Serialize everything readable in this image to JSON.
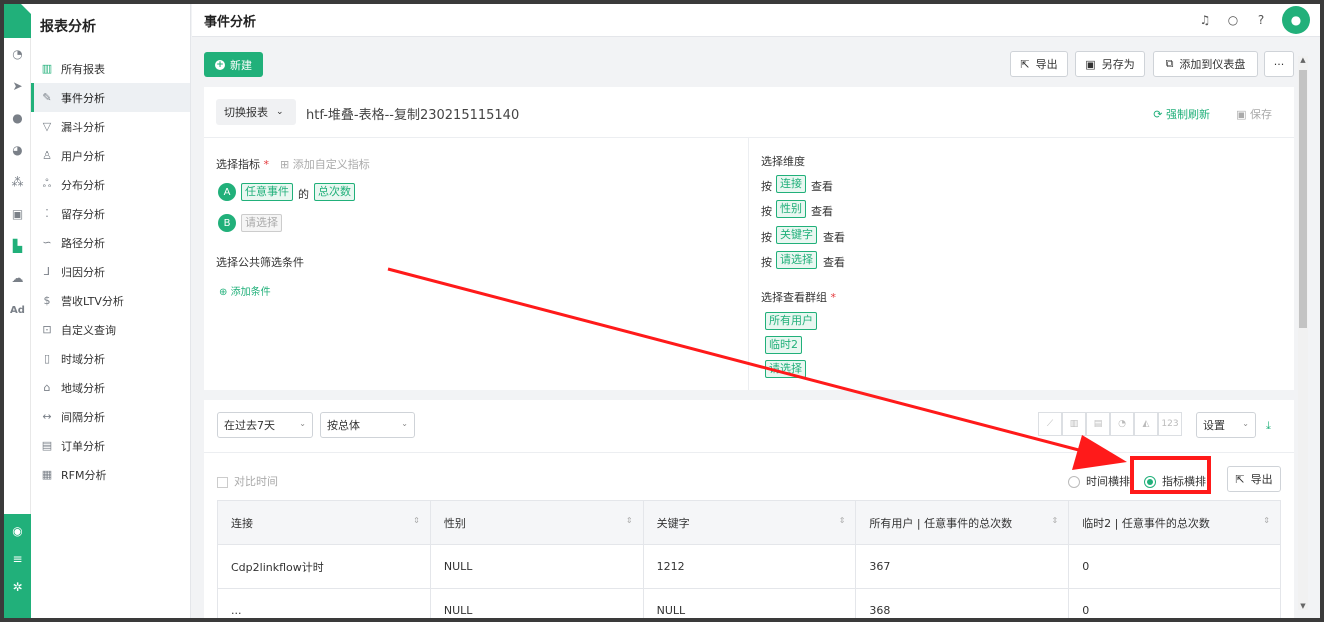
{
  "sidebar": {
    "title": "报表分析",
    "items": [
      {
        "label": "所有报表",
        "icon": "bar-chart-icon"
      },
      {
        "label": "事件分析",
        "icon": "edit-icon"
      },
      {
        "label": "漏斗分析",
        "icon": "funnel-icon"
      },
      {
        "label": "用户分析",
        "icon": "user-icon"
      },
      {
        "label": "分布分析",
        "icon": "distribution-icon"
      },
      {
        "label": "留存分析",
        "icon": "retention-icon"
      },
      {
        "label": "路径分析",
        "icon": "path-icon"
      },
      {
        "label": "归因分析",
        "icon": "attribution-icon"
      },
      {
        "label": "营收LTV分析",
        "icon": "revenue-icon"
      },
      {
        "label": "自定义查询",
        "icon": "query-icon"
      },
      {
        "label": "时域分析",
        "icon": "time-icon"
      },
      {
        "label": "地域分析",
        "icon": "map-icon"
      },
      {
        "label": "间隔分析",
        "icon": "interval-icon"
      },
      {
        "label": "订单分析",
        "icon": "order-icon"
      },
      {
        "label": "RFM分析",
        "icon": "rfm-icon"
      }
    ],
    "iconbar_ad": "Ad"
  },
  "header": {
    "title": "事件分析"
  },
  "toolbar": {
    "new_label": "新建",
    "export_label": "导出",
    "save_as_label": "另存为",
    "add_dashboard_label": "添加到仪表盘",
    "more_label": "···"
  },
  "report": {
    "switch_label": "切换报表",
    "name": "htf-堆叠-表格--复制230215115140",
    "refresh_label": "强制刷新",
    "save_label": "保存"
  },
  "metrics": {
    "title": "选择指标",
    "required": "*",
    "add_custom": "添加自定义指标",
    "a_letter": "A",
    "a_event": "任意事件",
    "a_of": "的",
    "a_measure": "总次数",
    "b_letter": "B",
    "b_placeholder": "请选择",
    "filter_title": "选择公共筛选条件",
    "add_condition": "添加条件"
  },
  "dimensions": {
    "title": "选择维度",
    "by": "按",
    "view": "查看",
    "items": [
      "连接",
      "性别",
      "关键字",
      "请选择"
    ],
    "group_title": "选择查看群组",
    "group_required": "*",
    "groups": [
      "所有用户",
      "临时2",
      "请选择"
    ]
  },
  "result": {
    "range_label": "在过去7天",
    "group_label": "按总体",
    "settings_label": "设置",
    "compare_label": "对比时间",
    "time_layout": "时间横排",
    "metric_layout": "指标横排",
    "export_label": "导出",
    "columns": [
      "连接",
      "性别",
      "关键字",
      "所有用户 | 任意事件的总次数",
      "临时2 | 任意事件的总次数"
    ],
    "rows": [
      [
        "Cdp2linkflow计时",
        "NULL",
        "1212",
        "367",
        "0"
      ],
      [
        "...",
        "NULL",
        "NULL",
        "368",
        "0"
      ]
    ]
  },
  "colors": {
    "accent": "#21b07a",
    "annotation": "#ff1a1a"
  }
}
